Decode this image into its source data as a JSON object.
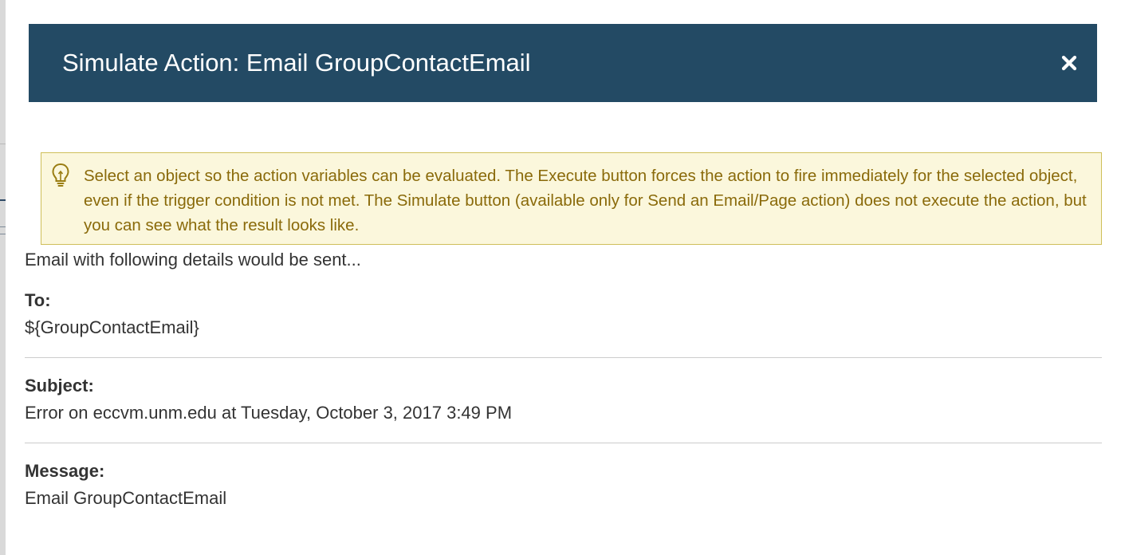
{
  "dialog": {
    "title": "Simulate Action: Email GroupContactEmail",
    "close_icon": "close-icon",
    "header_color": "#234a64"
  },
  "alert": {
    "icon": "lightbulb-icon",
    "text": "Select an object so the action variables can be evaluated. The Execute button forces the action to fire immediately for the selected object, even if the trigger condition is not met. The Simulate button (available only for Send an Email/Page action) does not execute the action, but you can see what the result looks like.",
    "background": "#fbf7dc",
    "text_color": "#8a6a0a"
  },
  "email": {
    "intro": "Email with following details would be sent...",
    "to_label": "To:",
    "to_value": "${GroupContactEmail}",
    "subject_label": "Subject:",
    "subject_value": "Error on eccvm.unm.edu at Tuesday, October 3, 2017 3:49 PM",
    "message_label": "Message:",
    "message_value": "Email GroupContactEmail"
  }
}
